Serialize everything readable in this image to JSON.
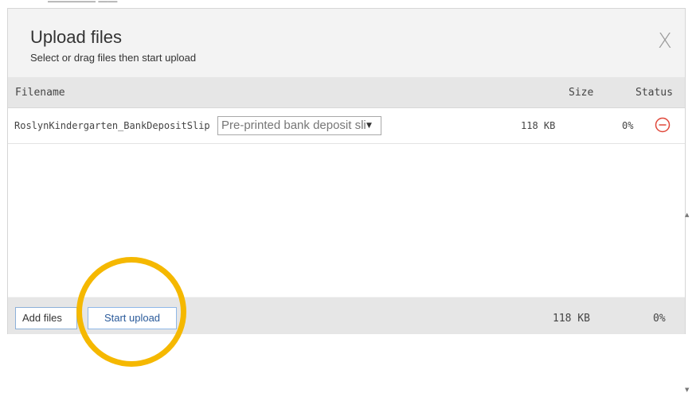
{
  "background": {
    "partial_text": "————— ——"
  },
  "dialog": {
    "title": "Upload files",
    "subtitle": "Select or drag files then start upload",
    "close_label": "X"
  },
  "table": {
    "headers": {
      "filename": "Filename",
      "size": "Size",
      "status": "Status"
    },
    "files": [
      {
        "name": "RoslynKindergarten_BankDepositSlip",
        "type_selected": "Pre-printed bank deposit slip",
        "size": "118 KB",
        "status": "0%"
      }
    ]
  },
  "footer": {
    "add_files_label": "Add files",
    "start_upload_label": "Start upload",
    "total_size": "118 KB",
    "total_status": "0%"
  },
  "colors": {
    "highlight": "#f5b800",
    "remove_icon": "#e0483a",
    "header_bg": "#e6e6e6",
    "dialog_bg": "#f3f3f3"
  },
  "icons": {
    "close": "close-icon",
    "remove": "minus-circle-icon",
    "dropdown": "dropdown-arrow-icon"
  }
}
